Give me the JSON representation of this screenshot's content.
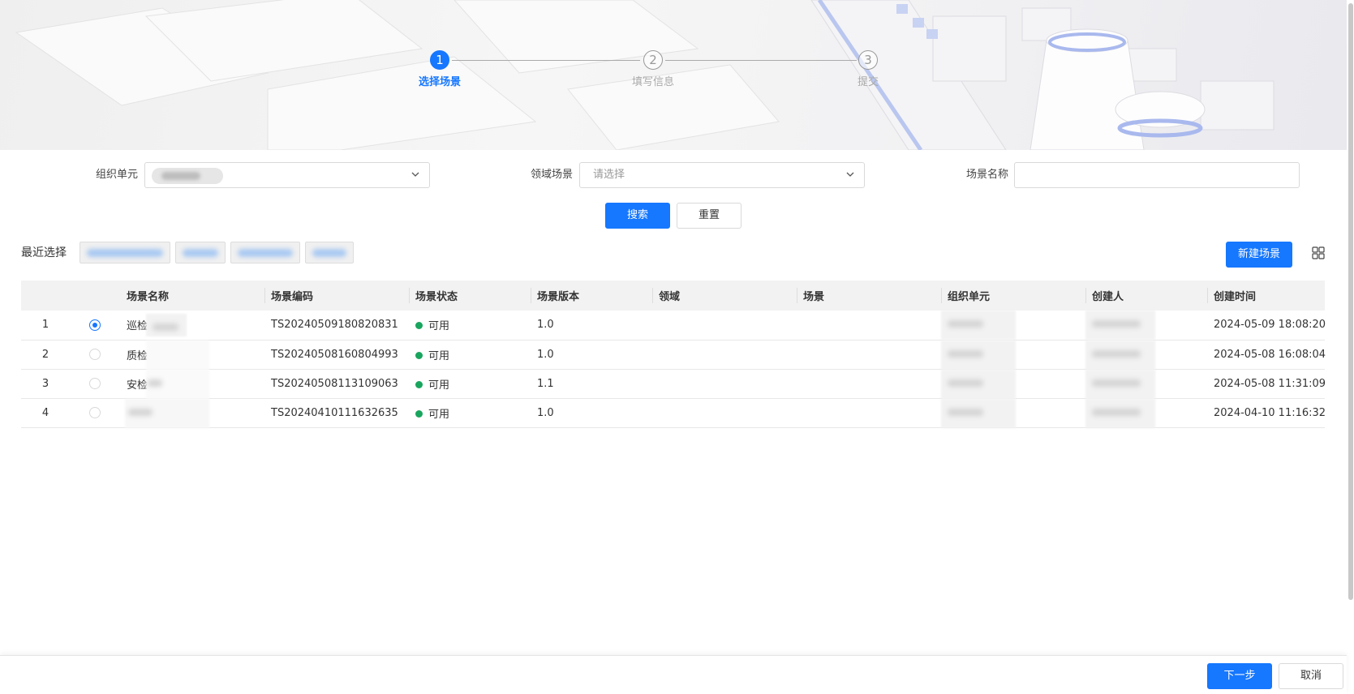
{
  "wizard": {
    "steps": [
      {
        "number": "1",
        "label": "选择场景",
        "state": "active"
      },
      {
        "number": "2",
        "label": "填写信息",
        "state": "pending"
      },
      {
        "number": "3",
        "label": "提交",
        "state": "pending"
      }
    ]
  },
  "filters": {
    "org_label": "组织单元",
    "domain_label": "领域场景",
    "domain_placeholder": "请选择",
    "name_label": "场景名称",
    "name_value": ""
  },
  "actions": {
    "search": "搜索",
    "reset": "重置",
    "new_scene": "新建场景"
  },
  "recent": {
    "label": "最近选择"
  },
  "table": {
    "columns": [
      "场景名称",
      "场景编码",
      "场景状态",
      "场景版本",
      "领域",
      "场景",
      "组织单元",
      "创建人",
      "创建时间"
    ],
    "rows": [
      {
        "index": "1",
        "selected": true,
        "name": "巡检",
        "code": "TS20240509180820831",
        "status": "可用",
        "version": "1.0",
        "domain": "",
        "scene": "",
        "created": "2024-05-09 18:08:20"
      },
      {
        "index": "2",
        "selected": false,
        "name": "质检",
        "code": "TS20240508160804993",
        "status": "可用",
        "version": "1.0",
        "domain": "",
        "scene": "",
        "created": "2024-05-08 16:08:04"
      },
      {
        "index": "3",
        "selected": false,
        "name": "安检",
        "code": "TS20240508113109063",
        "status": "可用",
        "version": "1.1",
        "domain": "",
        "scene": "",
        "created": "2024-05-08 11:31:09"
      },
      {
        "index": "4",
        "selected": false,
        "name": "",
        "code": "TS20240410111632635",
        "status": "可用",
        "version": "1.0",
        "domain": "",
        "scene": "",
        "created": "2024-04-10 11:16:32"
      }
    ]
  },
  "footer": {
    "next": "下一步",
    "cancel": "取消"
  },
  "colors": {
    "primary": "#1677ff",
    "status_ok": "#19a55e"
  }
}
